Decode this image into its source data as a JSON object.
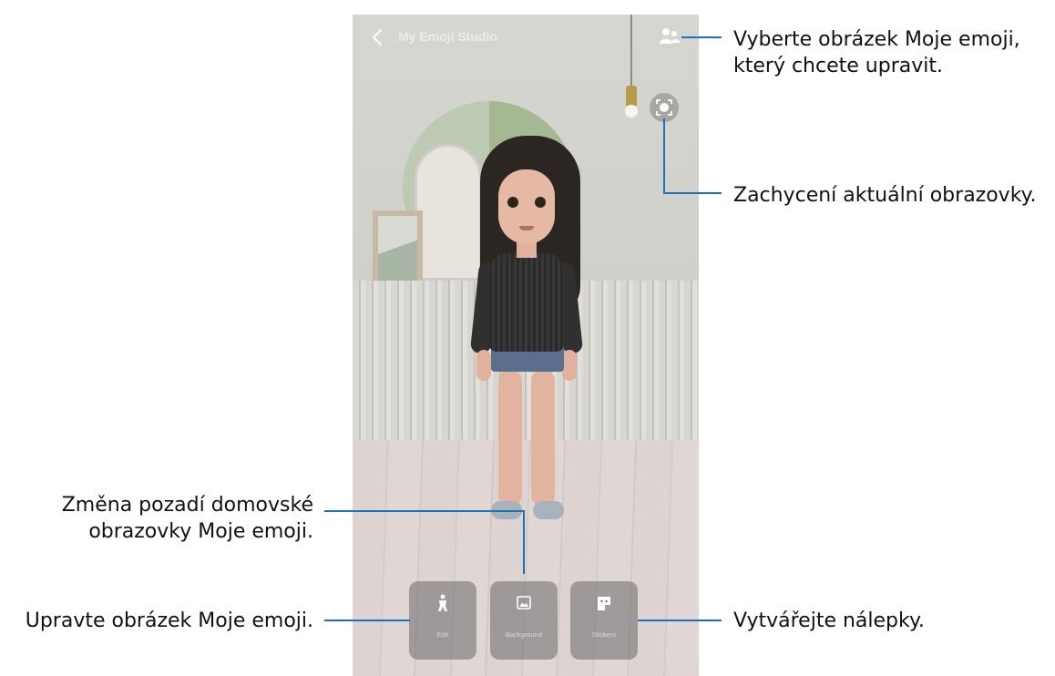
{
  "screen": {
    "title": "My Emoji Studio",
    "buttons": [
      {
        "label": "Edit",
        "icon": "person-icon"
      },
      {
        "label": "Background",
        "icon": "image-icon"
      },
      {
        "label": "Stickers",
        "icon": "sticker-icon"
      }
    ]
  },
  "callouts": {
    "select_emoji_line1": "Vyberte obrázek Moje emoji,",
    "select_emoji_line2": "který chcete upravit.",
    "capture_screen": "Zachycení aktuální obrazovky.",
    "change_background_line1": "Změna pozadí domovské",
    "change_background_line2": "obrazovky Moje emoji.",
    "edit_emoji": "Upravte obrázek Moje emoji.",
    "create_stickers": "Vytvářejte nálepky."
  },
  "colors": {
    "annotation_line": "#1d70b8",
    "callout_text": "#111111"
  }
}
